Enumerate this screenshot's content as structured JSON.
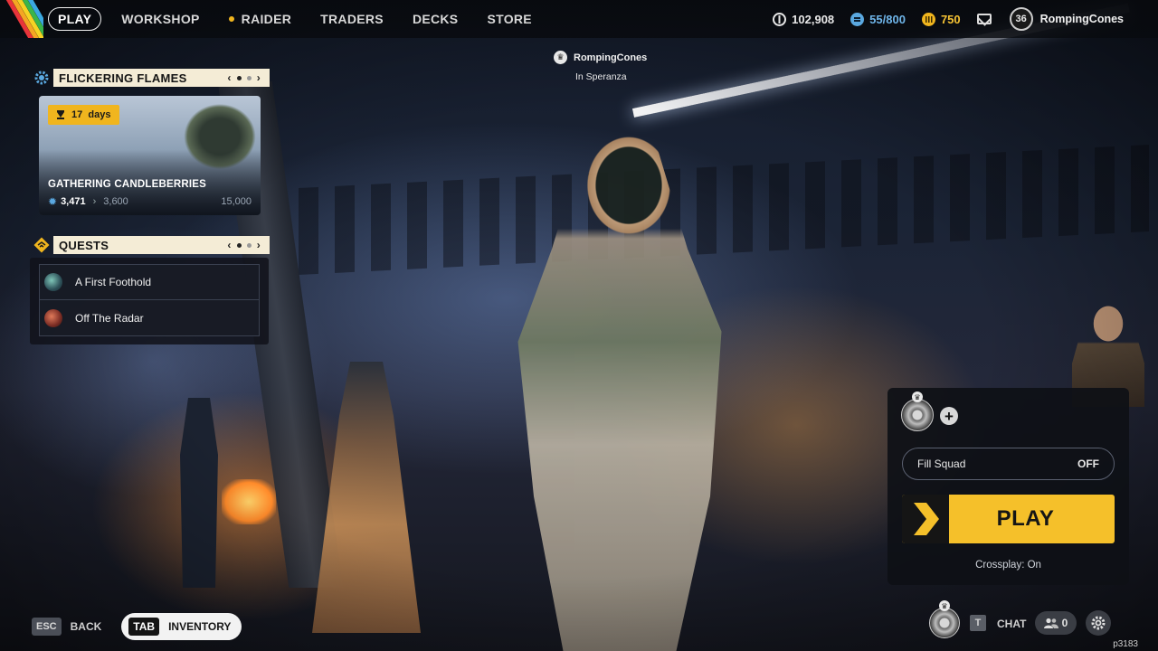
{
  "nav": {
    "items": [
      {
        "label": "PLAY",
        "active": true
      },
      {
        "label": "WORKSHOP"
      },
      {
        "label": "RAIDER",
        "dot_color": "#f0b51e"
      },
      {
        "label": "TRADERS"
      },
      {
        "label": "DECKS"
      },
      {
        "label": "STORE"
      }
    ]
  },
  "currencies": {
    "coins": "102,908",
    "blue": "55/800",
    "gold": "750"
  },
  "profile": {
    "level": "36",
    "username": "RompingCones"
  },
  "party": {
    "leader": "RompingCones",
    "location": "In Speranza"
  },
  "event": {
    "header": "FLICKERING FLAMES",
    "days_value": "17",
    "days_unit": "days",
    "title": "GATHERING CANDLEBERRIES",
    "progress": "3,471",
    "next_tier": "3,600",
    "max": "15,000"
  },
  "quests": {
    "header": "QUESTS",
    "items": [
      {
        "label": "A First Foothold",
        "icon": "quest-icon-teal"
      },
      {
        "label": "Off The Radar",
        "icon": "quest-icon-red"
      }
    ]
  },
  "play_panel": {
    "fill_squad_label": "Fill Squad",
    "fill_squad_value": "OFF",
    "play_label": "PLAY",
    "crossplay": "Crossplay: On"
  },
  "bottom": {
    "back_key": "ESC",
    "back_label": "BACK",
    "inventory_key": "TAB",
    "inventory_label": "INVENTORY",
    "chat_key": "T",
    "chat_label": "CHAT",
    "friends_count": "0"
  },
  "build": "p3183",
  "colors": {
    "accent_yellow": "#f5c02a",
    "header_cream": "#f4ecd6",
    "currency_blue": "#6fb6ea",
    "currency_gold": "#f5c233"
  }
}
